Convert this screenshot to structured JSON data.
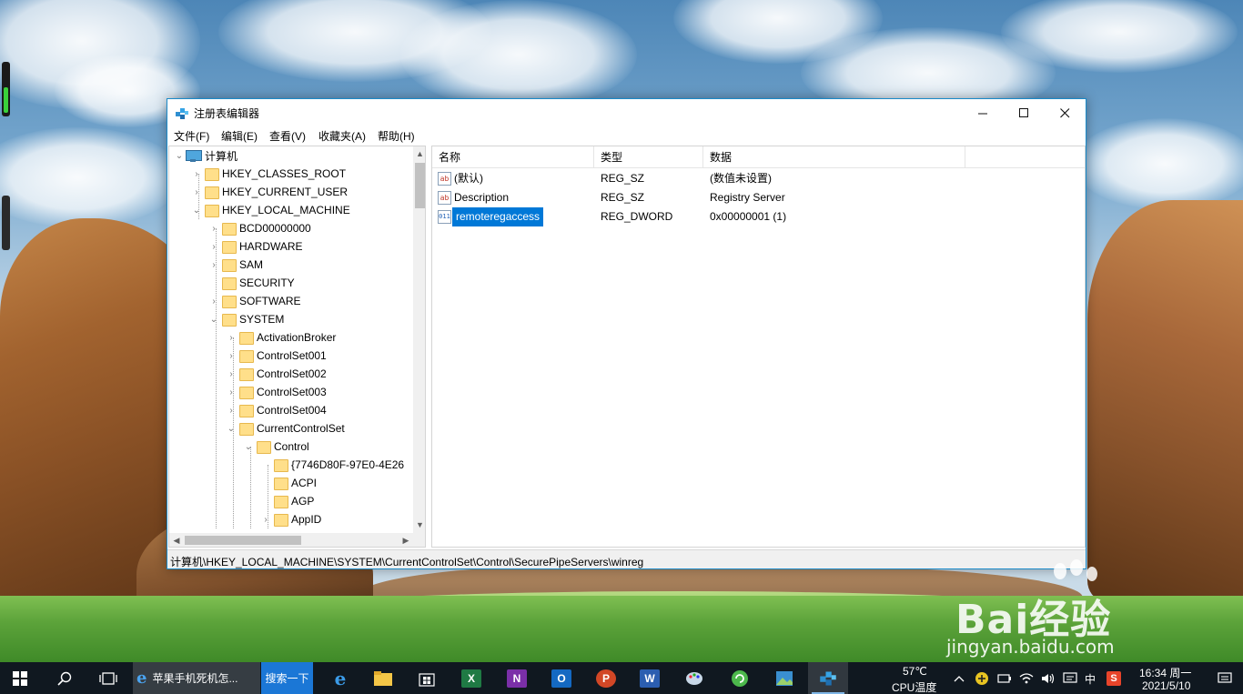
{
  "window": {
    "title": "注册表编辑器",
    "controls": {
      "minimize": "—",
      "maximize": "☐",
      "close": "✕"
    }
  },
  "menu": [
    "文件(F)",
    "编辑(E)",
    "查看(V)",
    "收藏夹(A)",
    "帮助(H)"
  ],
  "tree": {
    "root": "计算机",
    "nodes": [
      "HKEY_CLASSES_ROOT",
      "HKEY_CURRENT_USER",
      "HKEY_LOCAL_MACHINE",
      "BCD00000000",
      "HARDWARE",
      "SAM",
      "SECURITY",
      "SOFTWARE",
      "SYSTEM",
      "ActivationBroker",
      "ControlSet001",
      "ControlSet002",
      "ControlSet003",
      "ControlSet004",
      "CurrentControlSet",
      "Control",
      "{7746D80F-97E0-4E26",
      "ACPI",
      "AGP",
      "AppID"
    ]
  },
  "list": {
    "columns": [
      "名称",
      "类型",
      "数据"
    ],
    "rows": [
      {
        "name": "(默认)",
        "type": "REG_SZ",
        "data": "(数值未设置)",
        "icon": "ab"
      },
      {
        "name": "Description",
        "type": "REG_SZ",
        "data": "Registry Server",
        "icon": "ab"
      },
      {
        "name": "remoteregaccess",
        "type": "REG_DWORD",
        "data": "0x00000001 (1)",
        "icon": "binary"
      }
    ]
  },
  "status": {
    "path": "计算机\\HKEY_LOCAL_MACHINE\\SYSTEM\\CurrentControlSet\\Control\\SecurePipeServers\\winreg"
  },
  "watermark": {
    "logo": "Bai经验",
    "sub": "jingyan.baidu.com"
  },
  "taskbar": {
    "ie_task": "苹果手机死机怎...",
    "search_button": "搜索一下",
    "cpu_temp": "57℃",
    "cpu_label": "CPU温度",
    "ime": "中",
    "time": "16:34 周一",
    "date": "2021/5/10"
  },
  "colors": {
    "accent": "#0078d7",
    "window_border": "#1a8ac9",
    "taskbar": "#101820"
  }
}
